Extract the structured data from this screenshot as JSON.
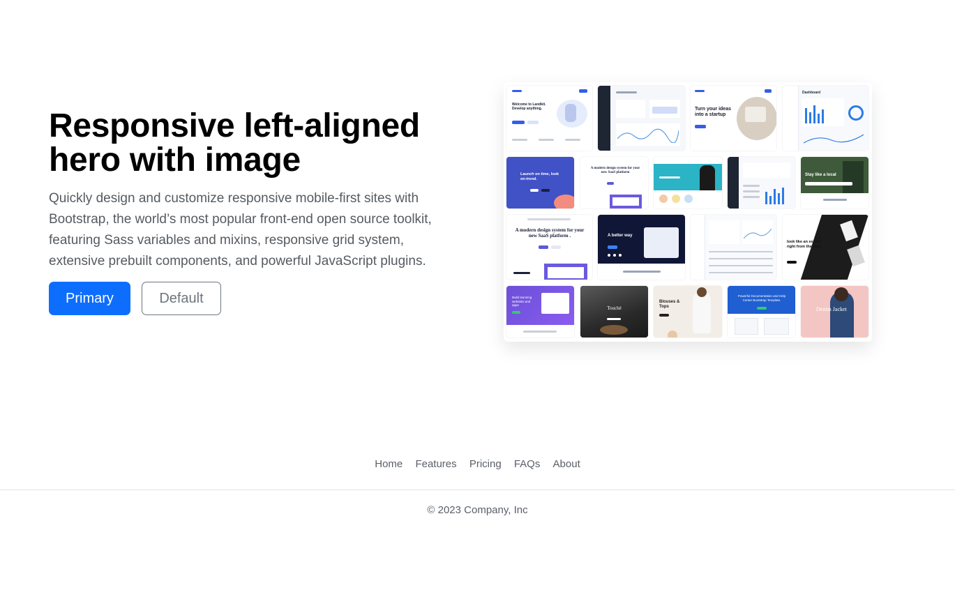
{
  "hero": {
    "title": "Responsive left-aligned hero with image",
    "lead": "Quickly design and customize responsive mobile-first sites with Bootstrap, the world’s most popular front-end open source toolkit, featuring Sass variables and mixins, responsive grid system, extensive prebuilt components, and powerful JavaScript plugins.",
    "primary_button": "Primary",
    "default_button": "Default"
  },
  "mosaic": {
    "tiles": [
      {
        "name": "landkit-theme",
        "heading": "Welcome to Landkit. Develop anything."
      },
      {
        "name": "dashboard-dark-sidebar-theme",
        "heading": ""
      },
      {
        "name": "startup-theme",
        "heading": "Turn your ideas into a startup"
      },
      {
        "name": "dashkit-theme",
        "heading": "Dashboard"
      },
      {
        "name": "launch-theme",
        "heading": "Launch on time, look on-trend."
      },
      {
        "name": "saas-design-theme-small",
        "heading": "A modern design system for your new SaaS platform"
      },
      {
        "name": "teal-product-theme",
        "heading": ""
      },
      {
        "name": "admin-dark-theme",
        "heading": ""
      },
      {
        "name": "travel-theme",
        "heading": "Stay like a local"
      },
      {
        "name": "saas-design-theme",
        "heading": "A modern design system for your new SaaS platform ."
      },
      {
        "name": "better-way-theme",
        "heading": "A better way"
      },
      {
        "name": "analytics-theme",
        "heading": ""
      },
      {
        "name": "agency-theme",
        "heading": "look like an expert right from the start"
      },
      {
        "name": "purple-landing-theme",
        "heading": "Build stunning websites and apps"
      },
      {
        "name": "restaurant-theme",
        "heading": "Touché"
      },
      {
        "name": "fashion-theme",
        "heading": "Blouses & Tops"
      },
      {
        "name": "documentation-theme",
        "heading": "Powerful Documentation and Help Center Bootstrap Template."
      },
      {
        "name": "denim-theme",
        "heading": "Denim Jacket"
      }
    ]
  },
  "footer": {
    "nav": [
      "Home",
      "Features",
      "Pricing",
      "FAQs",
      "About"
    ],
    "copyright": "© 2023 Company, Inc"
  },
  "colors": {
    "primary": "#0d6efd",
    "muted": "#6c757d",
    "rule": "#dee2e6"
  }
}
